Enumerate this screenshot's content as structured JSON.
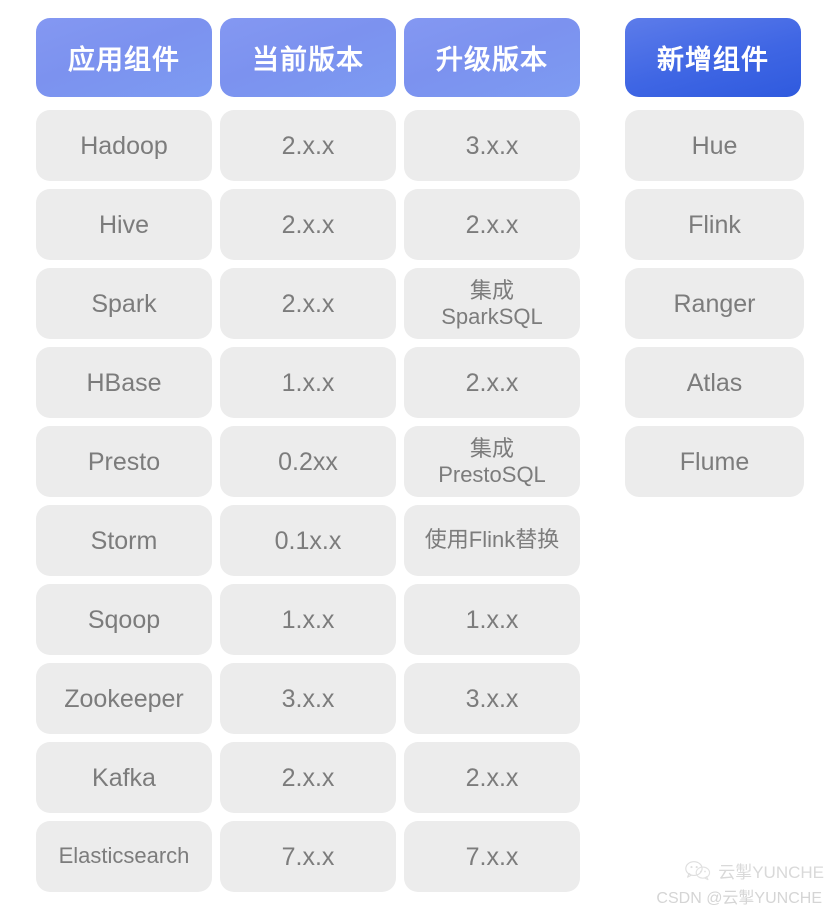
{
  "table": {
    "headers": [
      {
        "label": "应用组件",
        "style": "light"
      },
      {
        "label": "当前版本",
        "style": "light"
      },
      {
        "label": "升级版本",
        "style": "light"
      }
    ],
    "extra_header": {
      "label": "新增组件",
      "style": "strong"
    },
    "rows": [
      {
        "component": "Hadoop",
        "current": "2.x.x",
        "upgrade": "3.x.x"
      },
      {
        "component": "Hive",
        "current": "2.x.x",
        "upgrade": "2.x.x"
      },
      {
        "component": "Spark",
        "current": "2.x.x",
        "upgrade": "集成\nSparkSQL"
      },
      {
        "component": "HBase",
        "current": "1.x.x",
        "upgrade": "2.x.x"
      },
      {
        "component": "Presto",
        "current": "0.2xx",
        "upgrade": "集成\nPrestoSQL"
      },
      {
        "component": "Storm",
        "current": "0.1x.x",
        "upgrade": "使用Flink替换"
      },
      {
        "component": "Sqoop",
        "current": "1.x.x",
        "upgrade": "1.x.x"
      },
      {
        "component": "Zookeeper",
        "current": "3.x.x",
        "upgrade": "3.x.x"
      },
      {
        "component": "Kafka",
        "current": "2.x.x",
        "upgrade": "2.x.x"
      },
      {
        "component": "Elasticsearch",
        "current": "7.x.x",
        "upgrade": "7.x.x"
      }
    ],
    "new_components": [
      "Hue",
      "Flink",
      "Ranger",
      "Atlas",
      "Flume"
    ]
  },
  "watermark": {
    "icon": "wechat-icon",
    "brand": "云掣YUNCHE",
    "attribution": "CSDN @云掣YUNCHE"
  },
  "colors": {
    "header_light": "#7c92ef",
    "header_strong": "#3f66e4",
    "cell_bg": "#ececec",
    "cell_text": "#7c7c7c",
    "page_bg": "#ffffff"
  }
}
